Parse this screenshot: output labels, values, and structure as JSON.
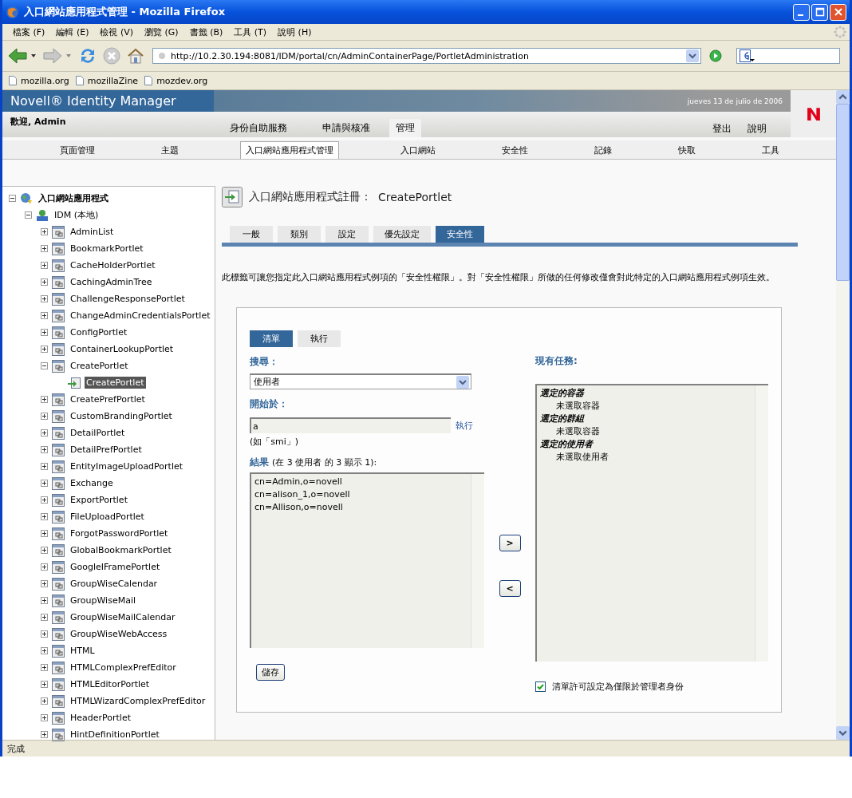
{
  "window": {
    "title": "入口網站應用程式管理 - Mozilla Firefox"
  },
  "menu": [
    "檔案 (F)",
    "編輯 (E)",
    "檢視 (V)",
    "瀏覽 (G)",
    "書籤 (B)",
    "工具 (T)",
    "說明 (H)"
  ],
  "address": {
    "value": "http://10.2.30.194:8081/IDM/portal/cn/AdminContainerPage/PortletAdministration"
  },
  "bookmarks": [
    "mozilla.org",
    "mozillaZine",
    "mozdev.org"
  ],
  "app": {
    "brand": "Novell® Identity Manager",
    "date": "jueves 13 de julio de 2006",
    "welcome": "歡迎, Admin",
    "main_tabs": [
      {
        "label": "身份自助服務",
        "selected": false
      },
      {
        "label": "申請與核准",
        "selected": false
      },
      {
        "label": "管理",
        "selected": true
      }
    ],
    "utility_links": [
      "登出",
      "說明"
    ],
    "sub_tabs": [
      {
        "label": "頁面管理",
        "selected": false
      },
      {
        "label": "主題",
        "selected": false
      },
      {
        "label": "入口網站應用程式管理",
        "selected": true
      },
      {
        "label": "入口網站",
        "selected": false
      },
      {
        "label": "安全性",
        "selected": false
      },
      {
        "label": "記錄",
        "selected": false
      },
      {
        "label": "快取",
        "selected": false
      },
      {
        "label": "工具",
        "selected": false
      }
    ]
  },
  "tree": {
    "items": [
      {
        "label": "入口網站應用程式",
        "kind": "root",
        "expanded": true,
        "selected": false,
        "children": [
          {
            "label": "IDM (本地)",
            "kind": "server",
            "expanded": true,
            "selected": false,
            "children": [
              {
                "label": "AdminList",
                "kind": "portlet",
                "expanded": false,
                "selected": false
              },
              {
                "label": "BookmarkPortlet",
                "kind": "portlet",
                "expanded": false,
                "selected": false
              },
              {
                "label": "CacheHolderPortlet",
                "kind": "portlet",
                "expanded": false,
                "selected": false
              },
              {
                "label": "CachingAdminTree",
                "kind": "portlet",
                "expanded": false,
                "selected": false
              },
              {
                "label": "ChallengeResponsePortlet",
                "kind": "portlet",
                "expanded": false,
                "selected": false
              },
              {
                "label": "ChangeAdminCredentialsPortlet",
                "kind": "portlet",
                "expanded": false,
                "selected": false
              },
              {
                "label": "ConfigPortlet",
                "kind": "portlet",
                "expanded": false,
                "selected": false
              },
              {
                "label": "ContainerLookupPortlet",
                "kind": "portlet",
                "expanded": false,
                "selected": false
              },
              {
                "label": "CreatePortlet",
                "kind": "portlet",
                "expanded": true,
                "selected": false,
                "children": [
                  {
                    "label": "CreatePortlet",
                    "kind": "instance",
                    "selected": true
                  }
                ]
              },
              {
                "label": "CreatePrefPortlet",
                "kind": "portlet",
                "expanded": false,
                "selected": false
              },
              {
                "label": "CustomBrandingPortlet",
                "kind": "portlet",
                "expanded": false,
                "selected": false
              },
              {
                "label": "DetailPortlet",
                "kind": "portlet",
                "expanded": false,
                "selected": false
              },
              {
                "label": "DetailPrefPortlet",
                "kind": "portlet",
                "expanded": false,
                "selected": false
              },
              {
                "label": "EntityImageUploadPortlet",
                "kind": "portlet",
                "expanded": false,
                "selected": false
              },
              {
                "label": "Exchange",
                "kind": "portlet",
                "expanded": false,
                "selected": false
              },
              {
                "label": "ExportPortlet",
                "kind": "portlet",
                "expanded": false,
                "selected": false
              },
              {
                "label": "FileUploadPortlet",
                "kind": "portlet",
                "expanded": false,
                "selected": false
              },
              {
                "label": "ForgotPasswordPortlet",
                "kind": "portlet",
                "expanded": false,
                "selected": false
              },
              {
                "label": "GlobalBookmarkPortlet",
                "kind": "portlet",
                "expanded": false,
                "selected": false
              },
              {
                "label": "GoogleIFramePortlet",
                "kind": "portlet",
                "expanded": false,
                "selected": false
              },
              {
                "label": "GroupWiseCalendar",
                "kind": "portlet",
                "expanded": false,
                "selected": false
              },
              {
                "label": "GroupWiseMail",
                "kind": "portlet",
                "expanded": false,
                "selected": false
              },
              {
                "label": "GroupWiseMailCalendar",
                "kind": "portlet",
                "expanded": false,
                "selected": false
              },
              {
                "label": "GroupWiseWebAccess",
                "kind": "portlet",
                "expanded": false,
                "selected": false
              },
              {
                "label": "HTML",
                "kind": "portlet",
                "expanded": false,
                "selected": false
              },
              {
                "label": "HTMLComplexPrefEditor",
                "kind": "portlet",
                "expanded": false,
                "selected": false
              },
              {
                "label": "HTMLEditorPortlet",
                "kind": "portlet",
                "expanded": false,
                "selected": false
              },
              {
                "label": "HTMLWizardComplexPrefEditor",
                "kind": "portlet",
                "expanded": false,
                "selected": false
              },
              {
                "label": "HeaderPortlet",
                "kind": "portlet",
                "expanded": false,
                "selected": false
              },
              {
                "label": "HintDefinitionPortlet",
                "kind": "portlet",
                "expanded": false,
                "selected": false
              }
            ]
          }
        ]
      }
    ]
  },
  "detail": {
    "title_label": "入口網站應用程式註冊：",
    "title_name": "CreatePortlet",
    "tabs": [
      {
        "label": "一般",
        "selected": false
      },
      {
        "label": "類別",
        "selected": false
      },
      {
        "label": "設定",
        "selected": false
      },
      {
        "label": "優先設定",
        "selected": false
      },
      {
        "label": "安全性",
        "selected": true
      }
    ],
    "description": "此標籤可讓您指定此入口網站應用程式例項的「安全性權限」。對「安全性權限」所做的任何修改僅會對此特定的入口網站應用程式例項生效。",
    "panel": {
      "mode_tabs": [
        {
          "label": "清單",
          "selected": true
        },
        {
          "label": "執行",
          "selected": false
        }
      ],
      "search_label": "搜尋：",
      "search_select": "使用者",
      "start_label": "開始於：",
      "start_value": "a",
      "go_link": "執行",
      "hint": "(如「smi」)",
      "results_label": "結果",
      "results_note": "(在 3 使用者 的 3 顯示 1):",
      "results": [
        "cn=Admin,o=novell",
        "cn=alison_1,o=novell",
        "cn=Allison,o=novell"
      ],
      "add_button": ">",
      "remove_button": "<",
      "current_label": "現有任務:",
      "assignments": [
        {
          "heading": "選定的容器",
          "items": [
            "未選取容器"
          ]
        },
        {
          "heading": "選定的群組",
          "items": [
            "未選取容器"
          ]
        },
        {
          "heading": "選定的使用者",
          "items": [
            "未選取使用者"
          ]
        }
      ],
      "save_button": "儲存",
      "admin_only": {
        "label": "清單許可設定為僅限於管理者身份",
        "checked": true
      }
    }
  },
  "status_bar": {
    "text": "完成"
  }
}
